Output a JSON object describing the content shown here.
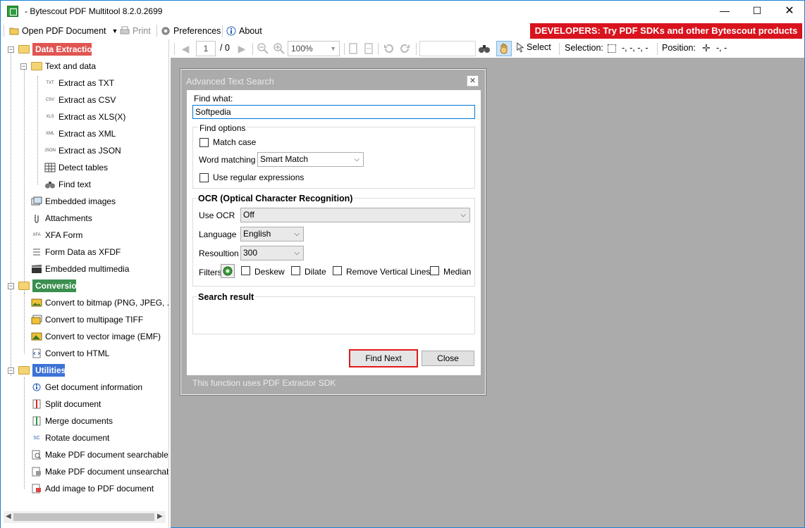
{
  "window": {
    "title": "- Bytescout PDF Multitool 8.2.0.2699",
    "minimize": "—",
    "maximize": "☐",
    "close": "✕"
  },
  "menubar": {
    "open": "Open PDF Document",
    "print": "Print",
    "preferences": "Preferences",
    "about": "About",
    "banner": "DEVELOPERS: Try PDF SDKs and other Bytescout products"
  },
  "tree": {
    "data_extraction": "Data Extraction",
    "text_and_data": "Text and data",
    "extract_txt": "Extract as TXT",
    "extract_csv": "Extract as CSV",
    "extract_xls": "Extract as XLS(X)",
    "extract_xml": "Extract as XML",
    "extract_json": "Extract as JSON",
    "detect_tables": "Detect tables",
    "find_text": "Find text",
    "embedded_images": "Embedded images",
    "attachments": "Attachments",
    "xfa_form": "XFA Form",
    "form_data_xfdf": "Form Data as XFDF",
    "embedded_multimedia": "Embedded multimedia",
    "conversion": "Conversion",
    "convert_bitmap": "Convert to bitmap (PNG, JPEG, ...)",
    "convert_tiff": "Convert to multipage TIFF",
    "convert_emf": "Convert to vector image (EMF)",
    "convert_html": "Convert to HTML",
    "utilities": "Utilities",
    "get_info": "Get document information",
    "split": "Split document",
    "merge": "Merge documents",
    "rotate": "Rotate document",
    "make_searchable": "Make PDF document searchable",
    "make_unsearchable": "Make PDF document unsearchable",
    "add_image": "Add image to PDF document",
    "tags": {
      "txt": "TXT",
      "csv": "CSV",
      "xls": "XLS",
      "xml": "XML",
      "json": "JSON",
      "xfa": "XFA",
      "sc": "SC"
    },
    "colors": {
      "data_extraction": "#e05552",
      "conversion": "#3a8f4f",
      "utilities": "#3c73d6"
    }
  },
  "toolbar": {
    "page": "1",
    "page_total": "/ 0",
    "zoom": "100%",
    "select": "Select",
    "selection_label": "Selection:",
    "selection_value": "-, -, -, -",
    "position_label": "Position:",
    "position_value": "-, -"
  },
  "dialog": {
    "title": "Advanced Text Search",
    "close": "✕",
    "find_what_label": "Find what:",
    "find_what_value": "Softpedia",
    "find_options": "Find options",
    "match_case": "Match case",
    "word_matching_label": "Word matching",
    "word_matching_value": "Smart Match",
    "use_regex": "Use regular expressions",
    "ocr_title": "OCR (Optical Character Recognition)",
    "use_ocr_label": "Use OCR",
    "use_ocr_value": "Off",
    "language_label": "Language",
    "language_value": "English",
    "resolution_label": "Resoultion",
    "resolution_value": "300",
    "filters_label": "Filters",
    "deskew": "Deskew",
    "dilate": "Dilate",
    "remove_lines": "Remove Vertical Lines",
    "median": "Median",
    "search_result": "Search result",
    "find_next": "Find Next",
    "close_btn": "Close",
    "footer": "This function uses PDF Extractor SDK"
  }
}
